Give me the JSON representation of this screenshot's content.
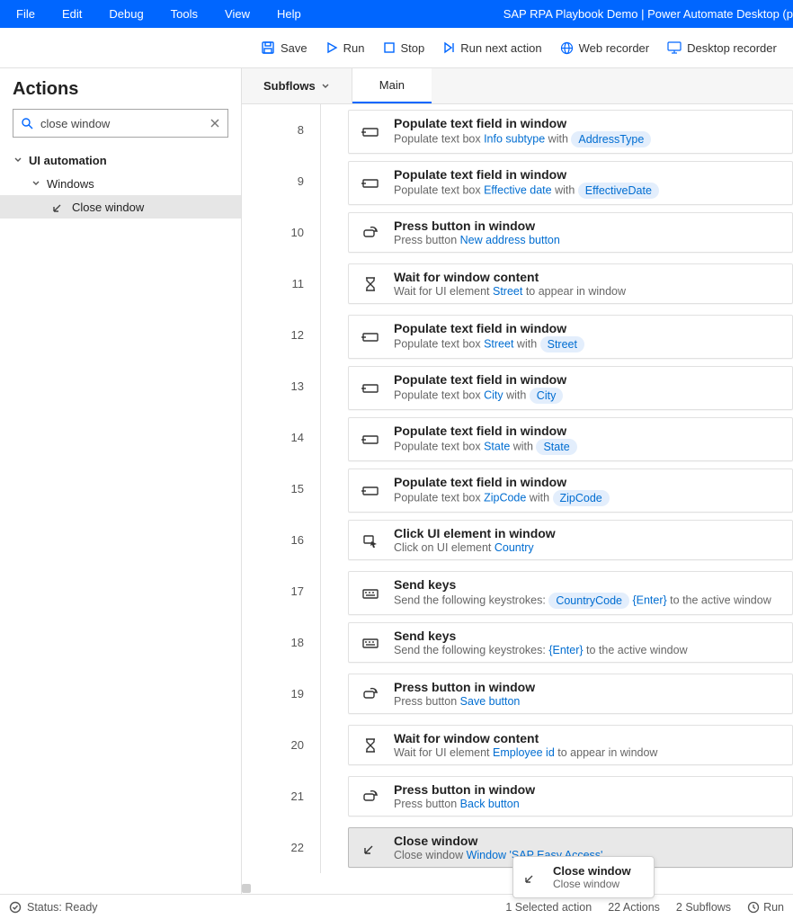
{
  "window_title": "SAP RPA Playbook Demo | Power Automate Desktop (p",
  "menubar": {
    "file": "File",
    "edit": "Edit",
    "debug": "Debug",
    "tools": "Tools",
    "view": "View",
    "help": "Help"
  },
  "toolbar": {
    "save": "Save",
    "run": "Run",
    "stop": "Stop",
    "run_next": "Run next action",
    "web_rec": "Web recorder",
    "desk_rec": "Desktop recorder"
  },
  "sidebar": {
    "title": "Actions",
    "search_value": "close window",
    "tree": {
      "root_label": "UI automation",
      "windows_label": "Windows",
      "close_window_label": "Close window"
    }
  },
  "tabs": {
    "subflows": "Subflows",
    "main": "Main"
  },
  "steps": [
    {
      "n": 8,
      "icon": "textbox",
      "title": "Populate text field in window",
      "parts": [
        "Populate text box ",
        {
          "link": "Info subtype"
        },
        " with ",
        {
          "pill": "AddressType"
        }
      ]
    },
    {
      "n": 9,
      "icon": "textbox",
      "title": "Populate text field in window",
      "parts": [
        "Populate text box ",
        {
          "link": "Effective date"
        },
        " with ",
        {
          "pill": "EffectiveDate"
        }
      ]
    },
    {
      "n": 10,
      "icon": "press",
      "title": "Press button in window",
      "parts": [
        "Press button ",
        {
          "link": "New address button"
        }
      ]
    },
    {
      "n": 11,
      "icon": "wait",
      "title": "Wait for window content",
      "parts": [
        "Wait for UI element ",
        {
          "link": "Street"
        },
        " to appear in window"
      ]
    },
    {
      "n": 12,
      "icon": "textbox",
      "title": "Populate text field in window",
      "parts": [
        "Populate text box ",
        {
          "link": "Street"
        },
        " with ",
        {
          "pill": "Street"
        }
      ]
    },
    {
      "n": 13,
      "icon": "textbox",
      "title": "Populate text field in window",
      "parts": [
        "Populate text box ",
        {
          "link": "City"
        },
        " with ",
        {
          "pill": "City"
        }
      ]
    },
    {
      "n": 14,
      "icon": "textbox",
      "title": "Populate text field in window",
      "parts": [
        "Populate text box ",
        {
          "link": "State"
        },
        " with ",
        {
          "pill": "State"
        }
      ]
    },
    {
      "n": 15,
      "icon": "textbox",
      "title": "Populate text field in window",
      "parts": [
        "Populate text box ",
        {
          "link": "ZipCode"
        },
        " with ",
        {
          "pill": "ZipCode"
        }
      ]
    },
    {
      "n": 16,
      "icon": "click",
      "title": "Click UI element in window",
      "parts": [
        "Click on UI element ",
        {
          "link": "Country"
        }
      ]
    },
    {
      "n": 17,
      "icon": "keys",
      "title": "Send keys",
      "parts": [
        "Send the following keystrokes: ",
        {
          "pill": "CountryCode"
        },
        " ",
        {
          "key": "{Enter}"
        },
        " to the active window"
      ]
    },
    {
      "n": 18,
      "icon": "keys",
      "title": "Send keys",
      "parts": [
        "Send the following keystrokes: ",
        {
          "key": "{Enter}"
        },
        " to the active window"
      ]
    },
    {
      "n": 19,
      "icon": "press",
      "title": "Press button in window",
      "parts": [
        "Press button ",
        {
          "link": "Save button"
        }
      ]
    },
    {
      "n": 20,
      "icon": "wait",
      "title": "Wait for window content",
      "parts": [
        "Wait for UI element ",
        {
          "link": "Employee id"
        },
        " to appear in window"
      ]
    },
    {
      "n": 21,
      "icon": "press",
      "title": "Press button in window",
      "parts": [
        "Press button ",
        {
          "link": "Back button"
        }
      ]
    },
    {
      "n": 22,
      "icon": "arrow-in",
      "title": "Close window",
      "selected": true,
      "parts": [
        "Close window ",
        {
          "link": "Window 'SAP Easy Access'"
        }
      ]
    }
  ],
  "tooltip": {
    "title": "Close window",
    "desc": "Close window"
  },
  "statusbar": {
    "ready": "Status: Ready",
    "selected": "1 Selected action",
    "actions": "22 Actions",
    "subflows": "2 Subflows",
    "run": "Run"
  }
}
